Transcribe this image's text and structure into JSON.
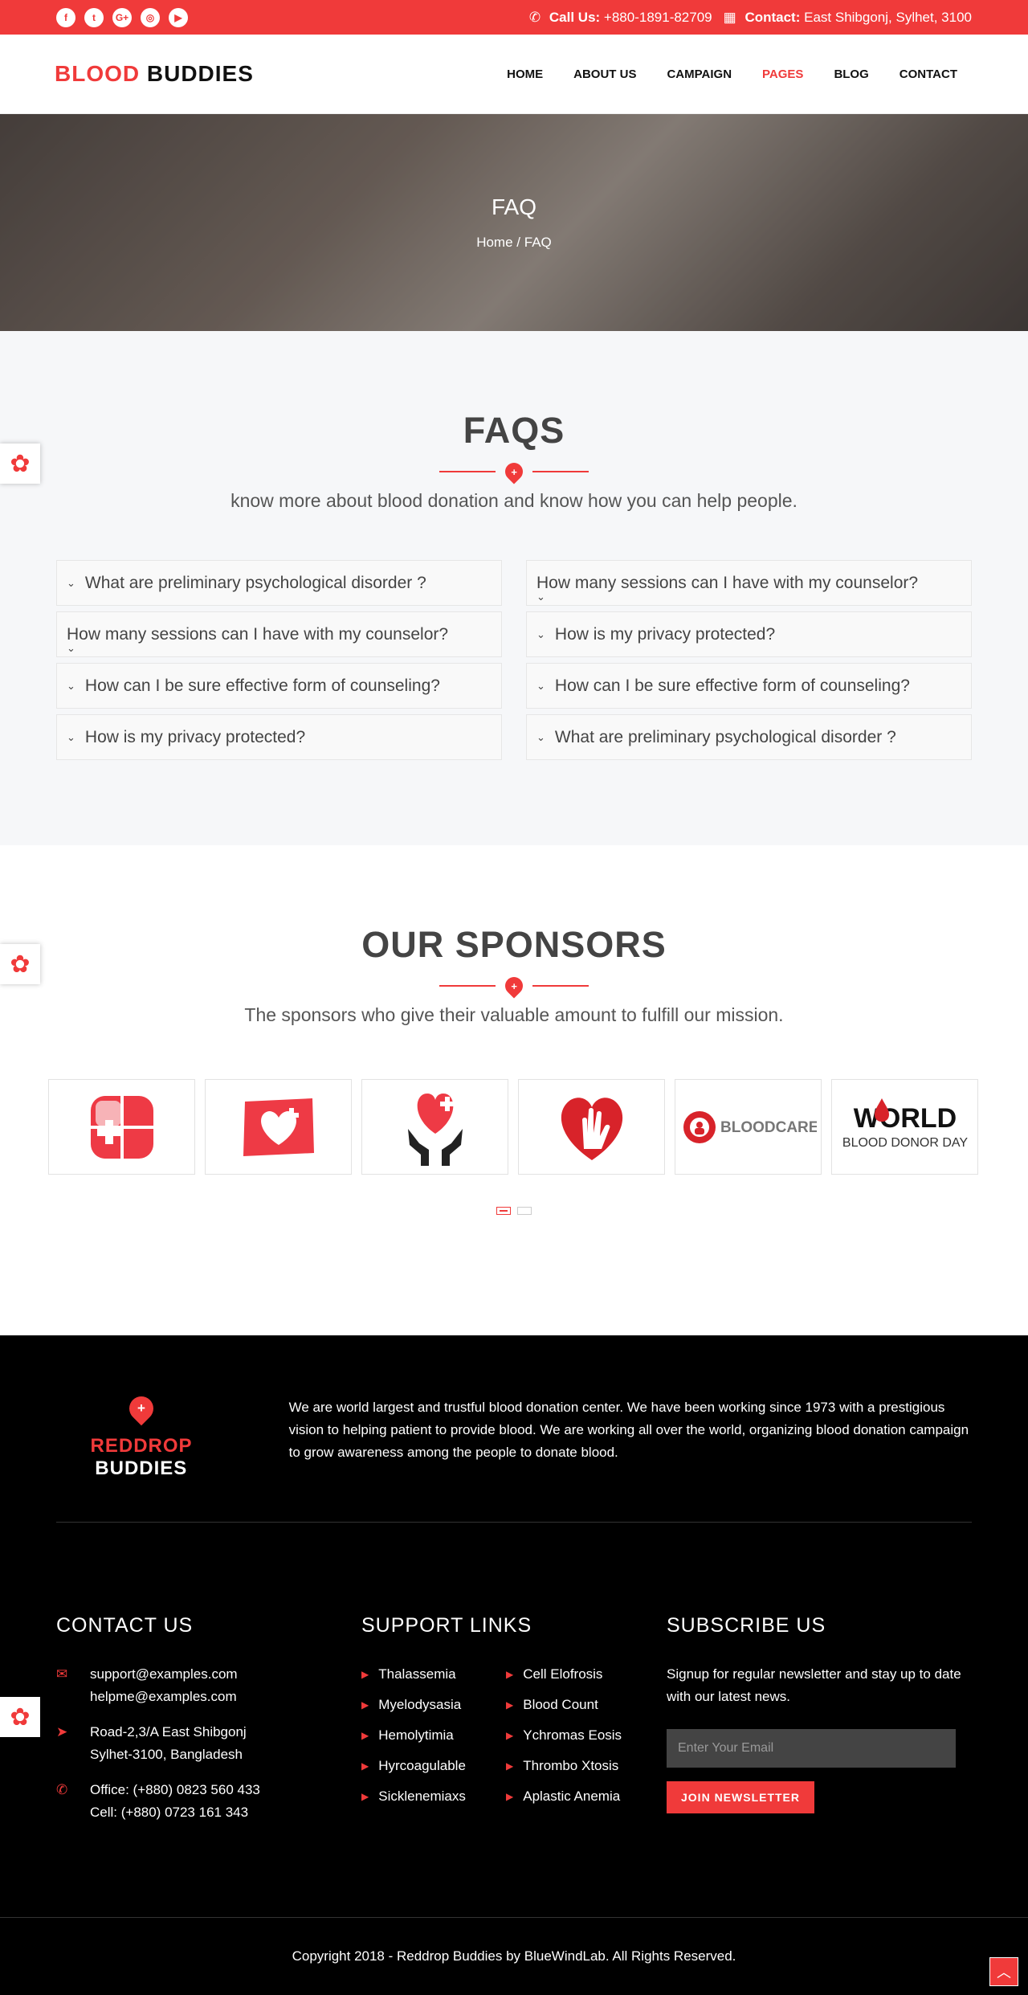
{
  "topbar": {
    "social_icons": [
      "facebook-icon",
      "twitter-icon",
      "google-plus-icon",
      "instagram-icon",
      "youtube-icon"
    ],
    "call_label": "Call Us:",
    "call_value": "+880-1891-82709",
    "contact_label": "Contact:",
    "contact_value": "East Shibgonj, Sylhet, 3100"
  },
  "header": {
    "logo_red": "BLOOD",
    "logo_dark": "BUDDIES",
    "nav": [
      "HOME",
      "ABOUT US",
      "CAMPAIGN",
      "PAGES",
      "BLOG",
      "CONTACT"
    ],
    "active_nav": "PAGES"
  },
  "hero": {
    "title": "FAQ",
    "crumb_home": "Home",
    "crumb_sep": "/",
    "crumb_current": "FAQ"
  },
  "faq": {
    "title": "FAQS",
    "subtitle": "know more about blood donation and know how you can help people.",
    "left": [
      "What are preliminary psychological disorder ?",
      "How many sessions can I have with my counselor?",
      "How can I be sure effective form of counseling?",
      "How is my privacy protected?"
    ],
    "right": [
      "How many sessions can I have with my counselor?",
      "How is my privacy protected?",
      "How can I be sure effective form of counseling?",
      "What are preliminary psychological disorder ?"
    ]
  },
  "sponsors": {
    "title": "OUR SPONSORS",
    "subtitle": "The sponsors who give their valuable amount to fulfill our mission.",
    "bloodcare_text": "BLOODCARE",
    "world_text": "WORLD",
    "donor_day_text": "BLOOD DONOR DAY"
  },
  "footer": {
    "logo_red": "REDDROP",
    "logo_white": "BUDDIES",
    "about": "We are world largest and trustful blood donation center. We have been working since 1973 with a prestigious vision to helping patient to provide blood. We are working all over the world, organizing blood donation campaign to grow awareness among the people to donate blood.",
    "contact_title": "CONTACT US",
    "email1": "support@examples.com",
    "email2": "helpme@examples.com",
    "address1": "Road-2,3/A East Shibgonj",
    "address2": "Sylhet-3100, Bangladesh",
    "phone1": "Office: (+880) 0823 560 433",
    "phone2": "Cell: (+880) 0723 161 343",
    "support_title": "SUPPORT LINKS",
    "links": [
      "Thalassemia",
      "Cell Elofrosis",
      "Myelodysasia",
      "Blood Count",
      "Hemolytimia",
      "Ychromas Eosis",
      "Hyrcoagulable",
      "Thrombo Xtosis",
      "Sicklenemiaxs",
      "Aplastic Anemia"
    ],
    "subscribe_title": "SUBSCRIBE US",
    "subscribe_text": "Signup for regular newsletter and stay up to date with our latest news.",
    "email_placeholder": "Enter Your Email",
    "join_label": "JOIN NEWSLETTER",
    "copyright": "Copyright 2018 - Reddrop Buddies by BlueWindLab. All Rights Reserved."
  },
  "colors": {
    "accent": "#f03a3a"
  }
}
